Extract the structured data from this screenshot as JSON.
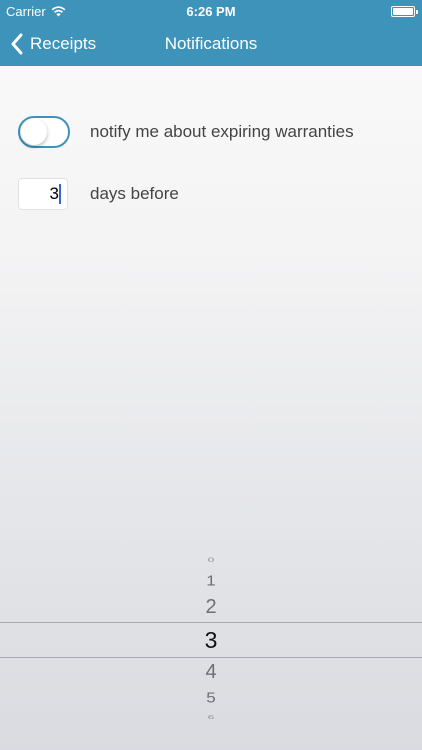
{
  "status_bar": {
    "carrier": "Carrier",
    "time": "6:26 PM"
  },
  "nav": {
    "back_label": "Receipts",
    "title": "Notifications"
  },
  "notify": {
    "label": "notify me about expiring warranties",
    "enabled": false
  },
  "days": {
    "value": "3",
    "label": "days before"
  },
  "picker": {
    "items": [
      "0",
      "1",
      "2",
      "3",
      "4",
      "5",
      "6"
    ],
    "selected": "3"
  },
  "colors": {
    "accent": "#3e93ba",
    "caret": "#3465d9"
  },
  "icons": [
    "wifi-icon",
    "battery-icon",
    "back-chevron-icon"
  ]
}
